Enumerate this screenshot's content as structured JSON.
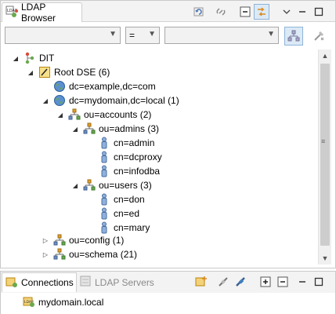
{
  "top_view": {
    "tab_title": "LDAP Browser",
    "toolbar_icons": [
      "refresh-icon",
      "link-icon",
      "collapse-all-icon",
      "link-with-editor-icon",
      "view-menu-icon",
      "minimize-icon",
      "maximize-icon"
    ]
  },
  "filter": {
    "attribute_value": "",
    "operator_value": "=",
    "filter_value": ""
  },
  "tree": {
    "root": "DIT",
    "root_dse": "Root DSE (6)",
    "example": "dc=example,dc=com",
    "mydomain": "dc=mydomain,dc=local (1)",
    "accounts": "ou=accounts (2)",
    "admins": "ou=admins (3)",
    "admin": "cn=admin",
    "dcproxy": "cn=dcproxy",
    "infodba": "cn=infodba",
    "users": "ou=users (3)",
    "don": "cn=don",
    "ed": "cn=ed",
    "mary": "cn=mary",
    "config": "ou=config (1)",
    "schema": "ou=schema (21)"
  },
  "bottom_view": {
    "tab_connections": "Connections",
    "tab_ldap_servers": "LDAP Servers",
    "connection_item": "mydomain.local"
  },
  "colors": {
    "folder_orange": "#e0a030",
    "entry_blue": "#6d8fc0",
    "group_green": "#6aa84f",
    "accent": "#3c7fc0"
  }
}
